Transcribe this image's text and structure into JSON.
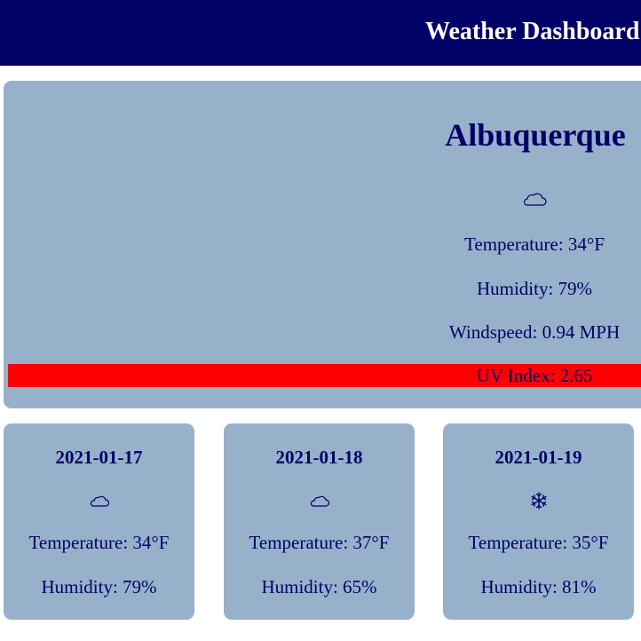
{
  "header": {
    "title": "Weather Dashboard"
  },
  "current": {
    "city": "Albuquerque",
    "icon": "cloud-icon",
    "temperature": "Temperature: 34°F",
    "humidity": "Humidity: 79%",
    "windspeed": "Windspeed: 0.94 MPH",
    "uv_index": "UV Index: 2.65",
    "uv_color": "#ff0000"
  },
  "forecast": [
    {
      "date": "2021-01-17",
      "icon": "cloud-icon",
      "temperature": "Temperature: 34°F",
      "humidity": "Humidity: 79%"
    },
    {
      "date": "2021-01-18",
      "icon": "cloud-icon",
      "temperature": "Temperature: 37°F",
      "humidity": "Humidity: 65%"
    },
    {
      "date": "2021-01-19",
      "icon": "snowflake-icon",
      "temperature": "Temperature: 35°F",
      "humidity": "Humidity: 81%"
    }
  ],
  "colors": {
    "header_bg": "#000066",
    "card_bg": "#97b1ca",
    "text": "#000066"
  }
}
